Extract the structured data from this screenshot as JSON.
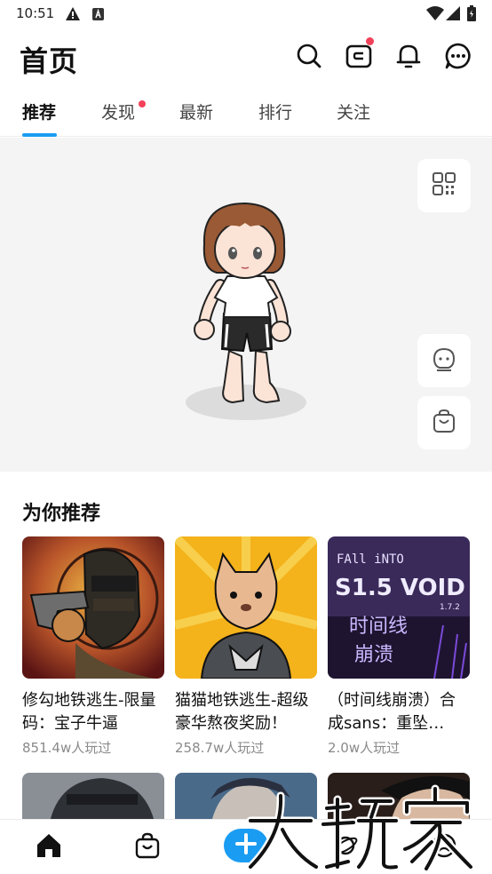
{
  "status_bar": {
    "time": "10:51",
    "icons": [
      "alert-icon",
      "app-notification-icon",
      "wifi-icon",
      "cell-signal-icon",
      "battery-icon"
    ]
  },
  "header": {
    "title": "首页",
    "icons": [
      "search-icon",
      "wallet-icon",
      "bell-icon",
      "chat-icon"
    ],
    "badges": {
      "wallet": true
    }
  },
  "tabs": [
    {
      "label": "推荐",
      "active": true
    },
    {
      "label": "发现",
      "badge": true
    },
    {
      "label": "最新"
    },
    {
      "label": "排行"
    },
    {
      "label": "关注"
    }
  ],
  "hero": {
    "side_buttons": [
      "qr-code-icon",
      "avatar-face-icon",
      "shopping-bag-icon"
    ]
  },
  "recommend": {
    "title": "为你推荐",
    "cards": [
      {
        "name": "修勾地铁逃生-限量码：宝子牛逼",
        "plays": "851.4w人玩过"
      },
      {
        "name": "猫猫地铁逃生-超级豪华熬夜奖励！",
        "plays": "258.7w人玩过"
      },
      {
        "name": "（时间线崩溃）合成sans：重坠…",
        "plays": "2.0w人玩过",
        "thumb_text": {
          "line1": "FAll iNTO",
          "big": "S1.5 VOID",
          "version": "1.7.2",
          "cn1": "时间线",
          "cn2": "崩溃"
        }
      }
    ]
  },
  "bottom_nav": {
    "items": [
      "home-icon",
      "shop-bag-icon",
      "create-plus-icon",
      "planet-icon",
      "profile-icon"
    ],
    "active": "home-icon"
  },
  "watermark": {
    "text": "大玩家"
  },
  "colors": {
    "accent": "#1a9cf2",
    "badge": "#f2415a",
    "hero_bg": "#f4f4f4",
    "muted": "#8a8a8a"
  }
}
